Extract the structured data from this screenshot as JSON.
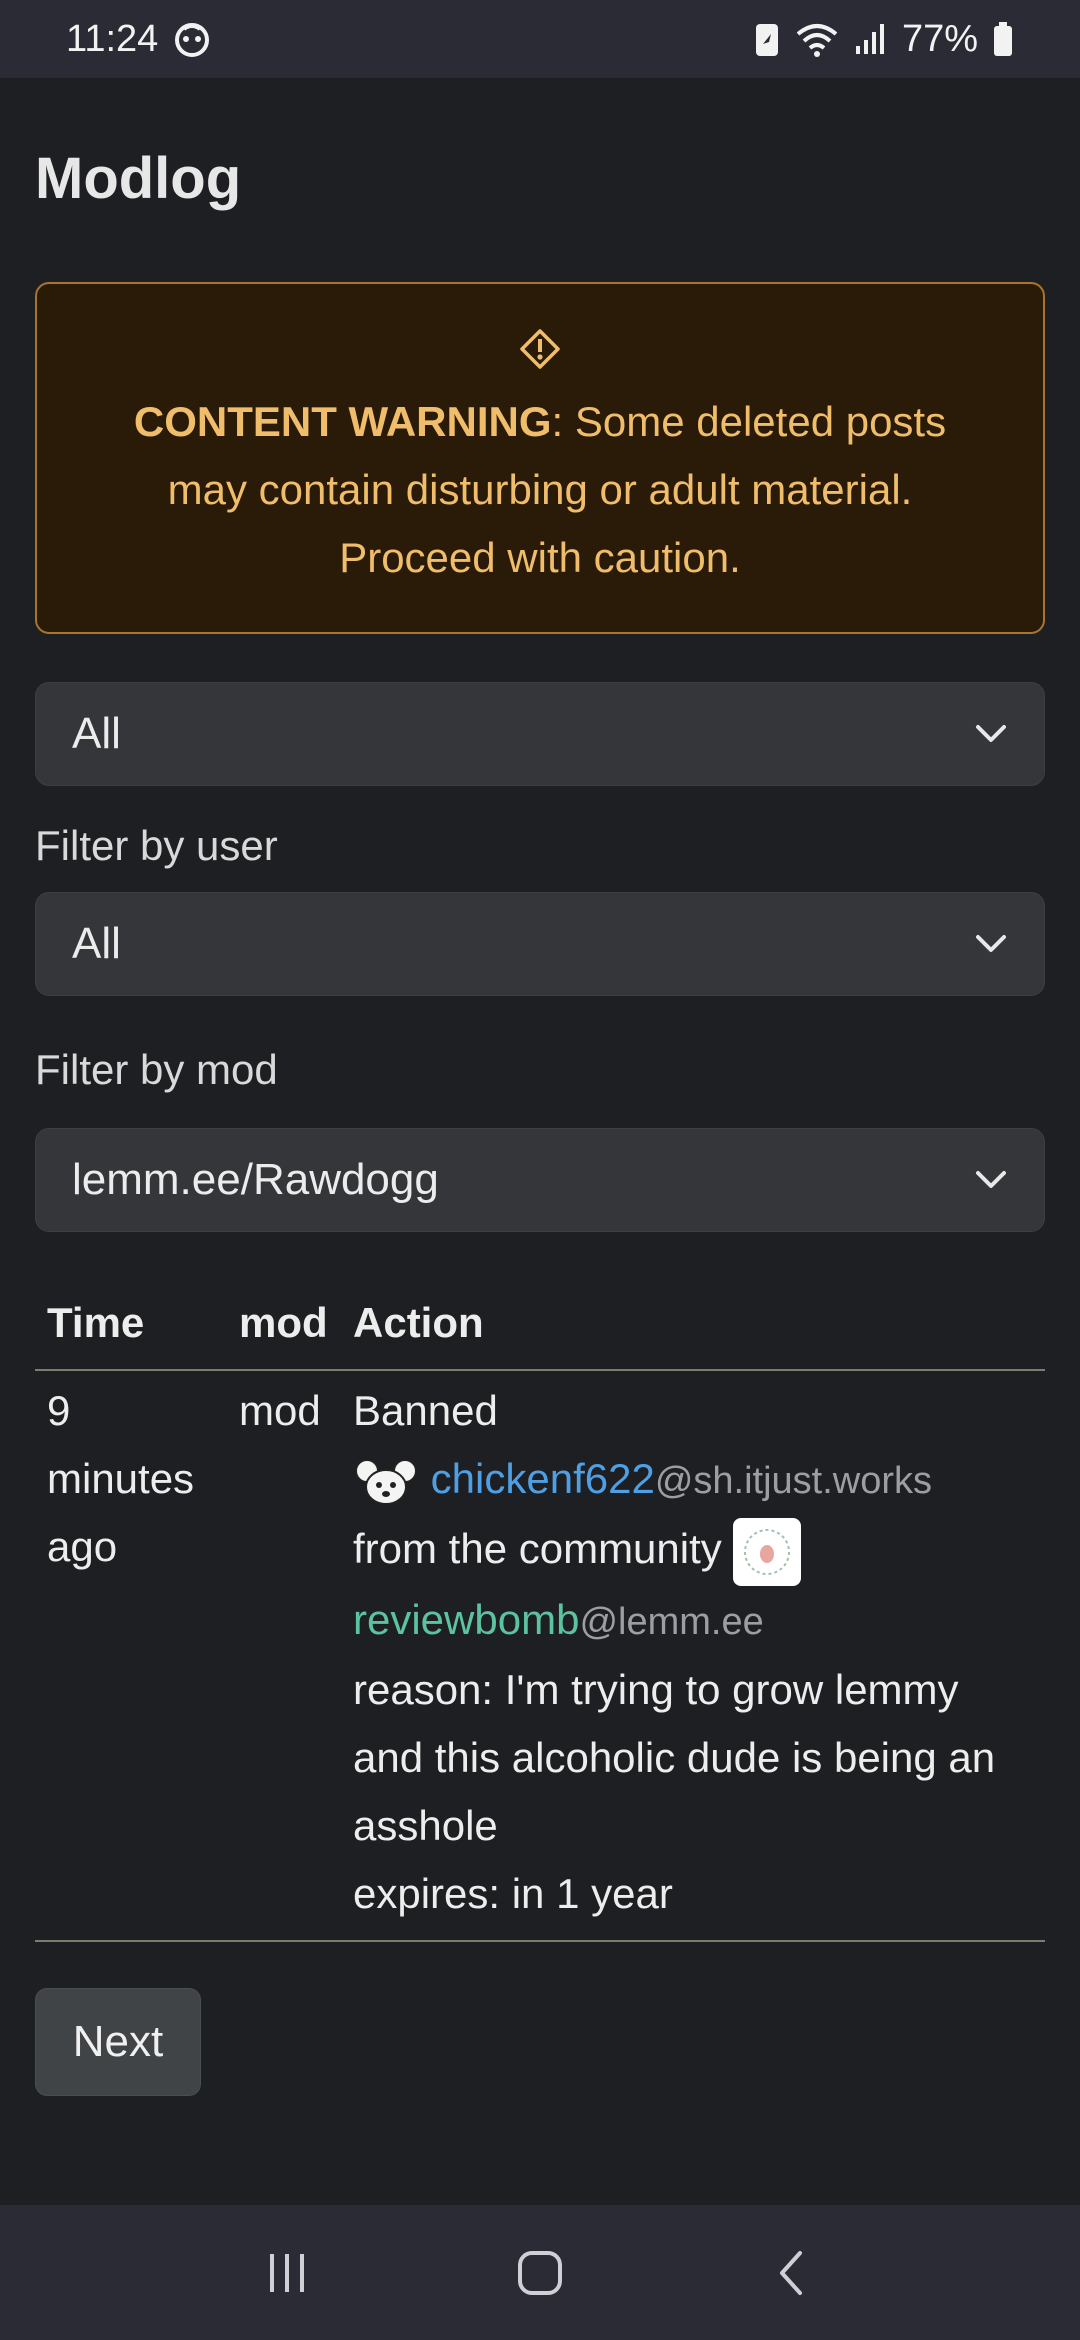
{
  "status_bar": {
    "time": "11:24",
    "battery": "77%"
  },
  "page": {
    "title": "Modlog"
  },
  "warning": {
    "label": "CONTENT WARNING",
    "message": ": Some deleted posts may contain disturbing or adult material. Proceed with caution."
  },
  "filters": {
    "action_type": {
      "value": "All"
    },
    "user": {
      "label": "Filter by user",
      "value": "All"
    },
    "mod": {
      "label": "Filter by mod",
      "value": "lemm.ee/Rawdogg"
    }
  },
  "table": {
    "headers": {
      "time": "Time",
      "mod": "mod",
      "action": "Action"
    },
    "rows": [
      {
        "time_num": "9",
        "time_unit": "minutes",
        "time_suffix": "ago",
        "mod": "mod",
        "action": "Banned",
        "user_name": "chickenf622",
        "user_instance": "@sh.itjust.works",
        "from_text": "from the community",
        "community_name": "reviewbomb",
        "community_instance": "@lemm.ee",
        "reason": "reason: I'm trying to grow lemmy and this alcoholic dude is being an asshole",
        "expires": "expires: in 1 year"
      }
    ]
  },
  "pagination": {
    "next_label": "Next"
  }
}
